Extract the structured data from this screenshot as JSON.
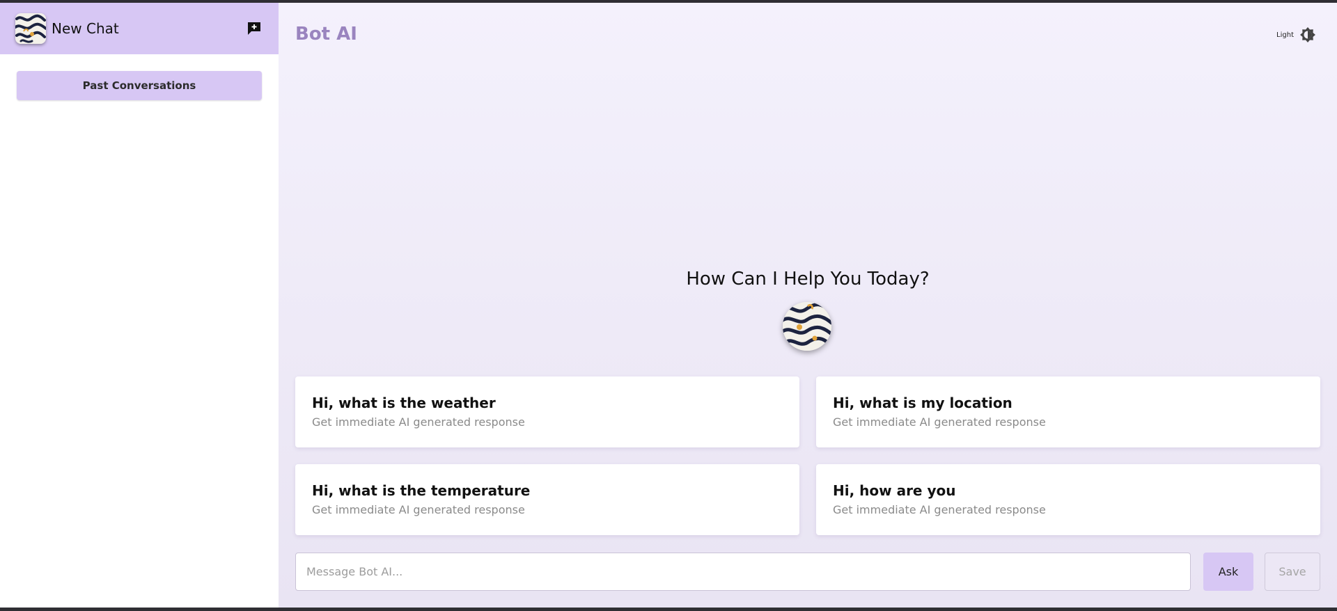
{
  "sidebar": {
    "new_chat_label": "New Chat",
    "avatar_icon": "abstract-pattern-avatar",
    "new_chat_icon": "add-chat-icon",
    "past_conversations_label": "Past Conversations"
  },
  "header": {
    "brand": "Bot AI",
    "theme_label": "Light",
    "theme_icon": "brightness-icon"
  },
  "hero": {
    "title": "How Can I Help You Today?",
    "avatar_icon": "bot-avatar-icon"
  },
  "suggestions": [
    {
      "title": "Hi, what is the weather",
      "subtitle": "Get immediate AI generated response"
    },
    {
      "title": "Hi, what is my location",
      "subtitle": "Get immediate AI generated response"
    },
    {
      "title": "Hi, what is the temperature",
      "subtitle": "Get immediate AI generated response"
    },
    {
      "title": "Hi, how are you",
      "subtitle": "Get immediate AI generated response"
    }
  ],
  "composer": {
    "placeholder": "Message Bot AI...",
    "value": "",
    "ask_label": "Ask",
    "save_label": "Save"
  },
  "colors": {
    "accent": "#d7c7f4",
    "brand_text": "#9a84bf",
    "main_bg_top": "#f4f1fc",
    "main_bg_bottom": "#e9e4f3"
  }
}
